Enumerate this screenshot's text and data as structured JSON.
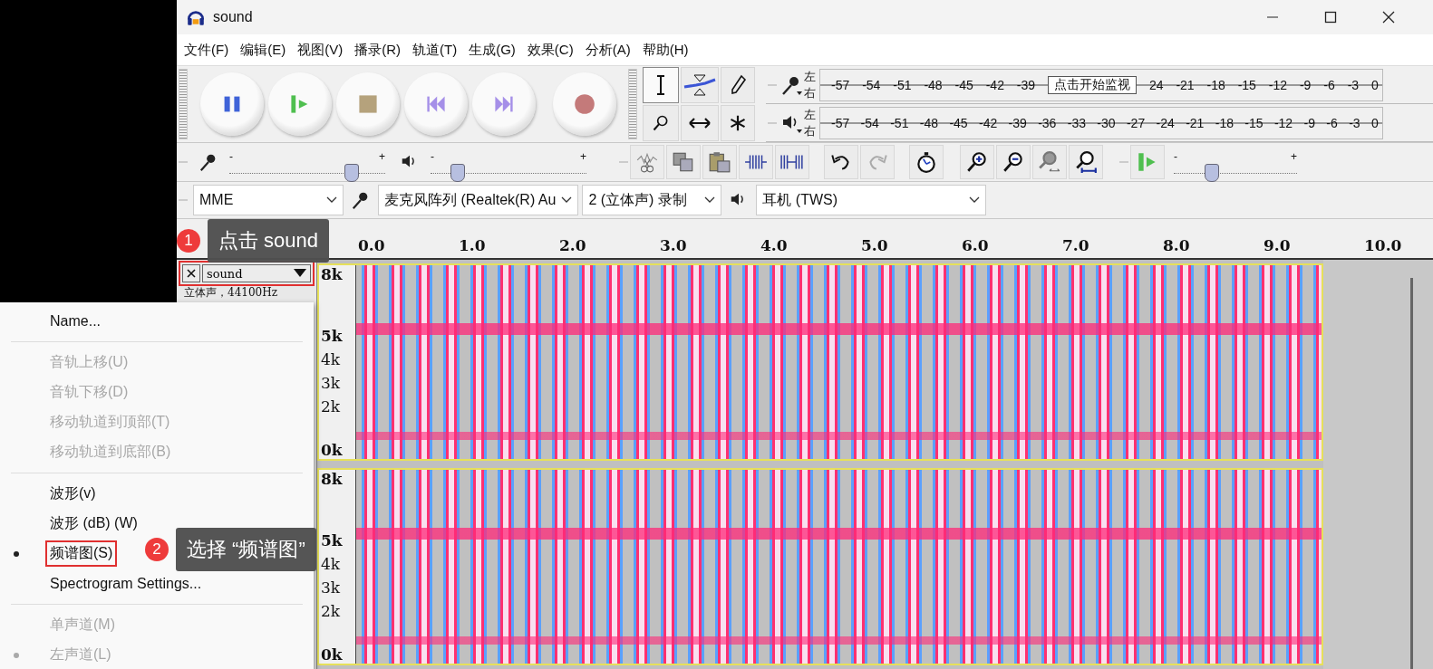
{
  "window": {
    "title": "sound"
  },
  "menu_bar": [
    {
      "label": "文件(F)"
    },
    {
      "label": "编辑(E)"
    },
    {
      "label": "视图(V)"
    },
    {
      "label": "播录(R)"
    },
    {
      "label": "轨道(T)"
    },
    {
      "label": "生成(G)"
    },
    {
      "label": "效果(C)"
    },
    {
      "label": "分析(A)"
    },
    {
      "label": "帮助(H)"
    }
  ],
  "tools": [
    {
      "kind": "select",
      "selected": true
    },
    {
      "kind": "envelope",
      "selected": false
    },
    {
      "kind": "draw",
      "selected": false
    },
    {
      "kind": "zoom",
      "selected": false
    },
    {
      "kind": "timeshift",
      "selected": false
    },
    {
      "kind": "multi",
      "selected": false
    }
  ],
  "meters": [
    {
      "kind": "record",
      "top_label": "左",
      "bottom_label": "右",
      "ticks": [
        "-57",
        "-54",
        "-51",
        "-48",
        "-45",
        "-42",
        "-39"
      ],
      "tooltip": "点击开始监视",
      "ticks_after_tooltip": [
        "24",
        "-21",
        "-18",
        "-15",
        "-12",
        "-9",
        "-6",
        "-3",
        "0"
      ]
    },
    {
      "kind": "playback",
      "top_label": "左",
      "bottom_label": "右",
      "ticks": [
        "-57",
        "-54",
        "-51",
        "-48",
        "-45",
        "-42",
        "-39",
        "-36",
        "-33",
        "-30",
        "-27",
        "-24",
        "-21",
        "-18",
        "-15",
        "-12",
        "-9",
        "-6",
        "-3",
        "0"
      ]
    }
  ],
  "mixer": [
    {
      "kind": "record",
      "minus": "-",
      "plus": "+",
      "level": 0.78
    },
    {
      "kind": "playback",
      "minus": "-",
      "plus": "+",
      "level": 0.17
    }
  ],
  "play_at_speed": {
    "minus": "-",
    "plus": "+",
    "level": 0.3
  },
  "devices": {
    "host": "MME",
    "input": "麦克风阵列 (Realtek(R) Au",
    "channels": "2 (立体声) 录制",
    "output": "耳机 (TWS)"
  },
  "ruler": {
    "ticks": [
      "0.0",
      "1.0",
      "2.0",
      "3.0",
      "4.0",
      "5.0",
      "6.0",
      "7.0",
      "8.0",
      "9.0",
      "10.0"
    ]
  },
  "track": {
    "name": "sound",
    "info": "立体声，44100Hz",
    "highlighted": true,
    "channels": [
      {
        "scale": [
          "8k",
          "5k",
          "4k",
          "3k",
          "2k",
          "0k"
        ]
      },
      {
        "scale": [
          "8k",
          "5k",
          "4k",
          "3k",
          "2k",
          "0k"
        ]
      }
    ]
  },
  "context_menu": [
    {
      "kind": "item",
      "label": "Name...",
      "disabled": false,
      "checked": false,
      "highlighted": false
    },
    {
      "kind": "separator"
    },
    {
      "kind": "item",
      "label": "音轨上移(U)",
      "disabled": true,
      "checked": false,
      "highlighted": false
    },
    {
      "kind": "item",
      "label": "音轨下移(D)",
      "disabled": true,
      "checked": false,
      "highlighted": false
    },
    {
      "kind": "item",
      "label": "移动轨道到顶部(T)",
      "disabled": true,
      "checked": false,
      "highlighted": false
    },
    {
      "kind": "item",
      "label": "移动轨道到底部(B)",
      "disabled": true,
      "checked": false,
      "highlighted": false
    },
    {
      "kind": "separator"
    },
    {
      "kind": "item",
      "label": "波形(v)",
      "disabled": false,
      "checked": false,
      "highlighted": false
    },
    {
      "kind": "item",
      "label": "波形 (dB) (W)",
      "disabled": false,
      "checked": false,
      "highlighted": false
    },
    {
      "kind": "item",
      "label": "频谱图(S)",
      "disabled": false,
      "checked": true,
      "highlighted": true
    },
    {
      "kind": "item",
      "label": "Spectrogram Settings...",
      "disabled": false,
      "checked": false,
      "highlighted": false
    },
    {
      "kind": "separator"
    },
    {
      "kind": "item",
      "label": "单声道(M)",
      "disabled": true,
      "checked": false,
      "highlighted": false
    },
    {
      "kind": "item",
      "label": "左声道(L)",
      "disabled": true,
      "checked": true,
      "highlighted": false
    }
  ],
  "callouts": [
    {
      "number": "1",
      "text": "点击 sound"
    },
    {
      "number": "2",
      "text": "选择 “频谱图”"
    }
  ]
}
